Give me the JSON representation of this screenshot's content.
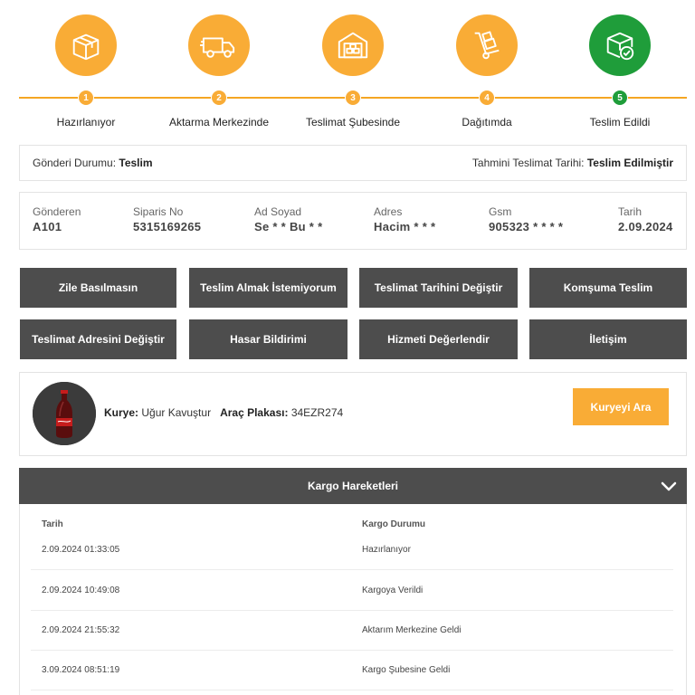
{
  "steps": [
    {
      "number": "1",
      "label": "Hazırlanıyor",
      "icon": "package-box-icon",
      "state": "active"
    },
    {
      "number": "2",
      "label": "Aktarma Merkezinde",
      "icon": "delivery-truck-icon",
      "state": "active"
    },
    {
      "number": "3",
      "label": "Teslimat Şubesinde",
      "icon": "warehouse-icon",
      "state": "active"
    },
    {
      "number": "4",
      "label": "Dağıtımda",
      "icon": "hand-truck-icon",
      "state": "active"
    },
    {
      "number": "5",
      "label": "Teslim Edildi",
      "icon": "delivered-package-check-icon",
      "state": "done"
    }
  ],
  "colors": {
    "accent": "#f9ac36",
    "done": "#1f9d3a",
    "dark": "#4d4d4d"
  },
  "status": {
    "label": "Gönderi Durumu:",
    "value": "Teslim",
    "eta_label": "Tahmini Teslimat Tarihi:",
    "eta_value": "Teslim Edilmiştir"
  },
  "shipment": {
    "sender_label": "Gönderen",
    "sender": "A101",
    "order_label": "Siparis No",
    "order": "5315169265",
    "name_label": "Ad Soyad",
    "name": "Se * * Bu * *",
    "address_label": "Adres",
    "address": "Hacim * * *",
    "gsm_label": "Gsm",
    "gsm": "905323 * * * *",
    "date_label": "Tarih",
    "date": "2.09.2024"
  },
  "actions": [
    "Zile Basılmasın",
    "Teslim Almak İstemiyorum",
    "Teslimat Tarihini Değiştir",
    "Komşuma Teslim",
    "Teslimat Adresini Değiştir",
    "Hasar Bildirimi",
    "Hizmeti Değerlendir",
    "İletişim"
  ],
  "courier": {
    "courier_label": "Kurye:",
    "courier_name": "Uğur Kavuştur",
    "plate_label": "Araç Plakası:",
    "plate": "34EZR274",
    "call_button": "Kuryeyi Ara",
    "avatar_icon": "soda-bottle-avatar-icon"
  },
  "movements": {
    "title": "Kargo Hareketleri",
    "col_date": "Tarih",
    "col_status": "Kargo Durumu",
    "rows": [
      {
        "date": "2.09.2024 01:33:05",
        "status": "Hazırlanıyor"
      },
      {
        "date": "2.09.2024 10:49:08",
        "status": "Kargoya Verildi"
      },
      {
        "date": "2.09.2024 21:55:32",
        "status": "Aktarım Merkezine Geldi"
      },
      {
        "date": "3.09.2024 08:51:19",
        "status": "Kargo Şubesine Geldi"
      }
    ]
  }
}
